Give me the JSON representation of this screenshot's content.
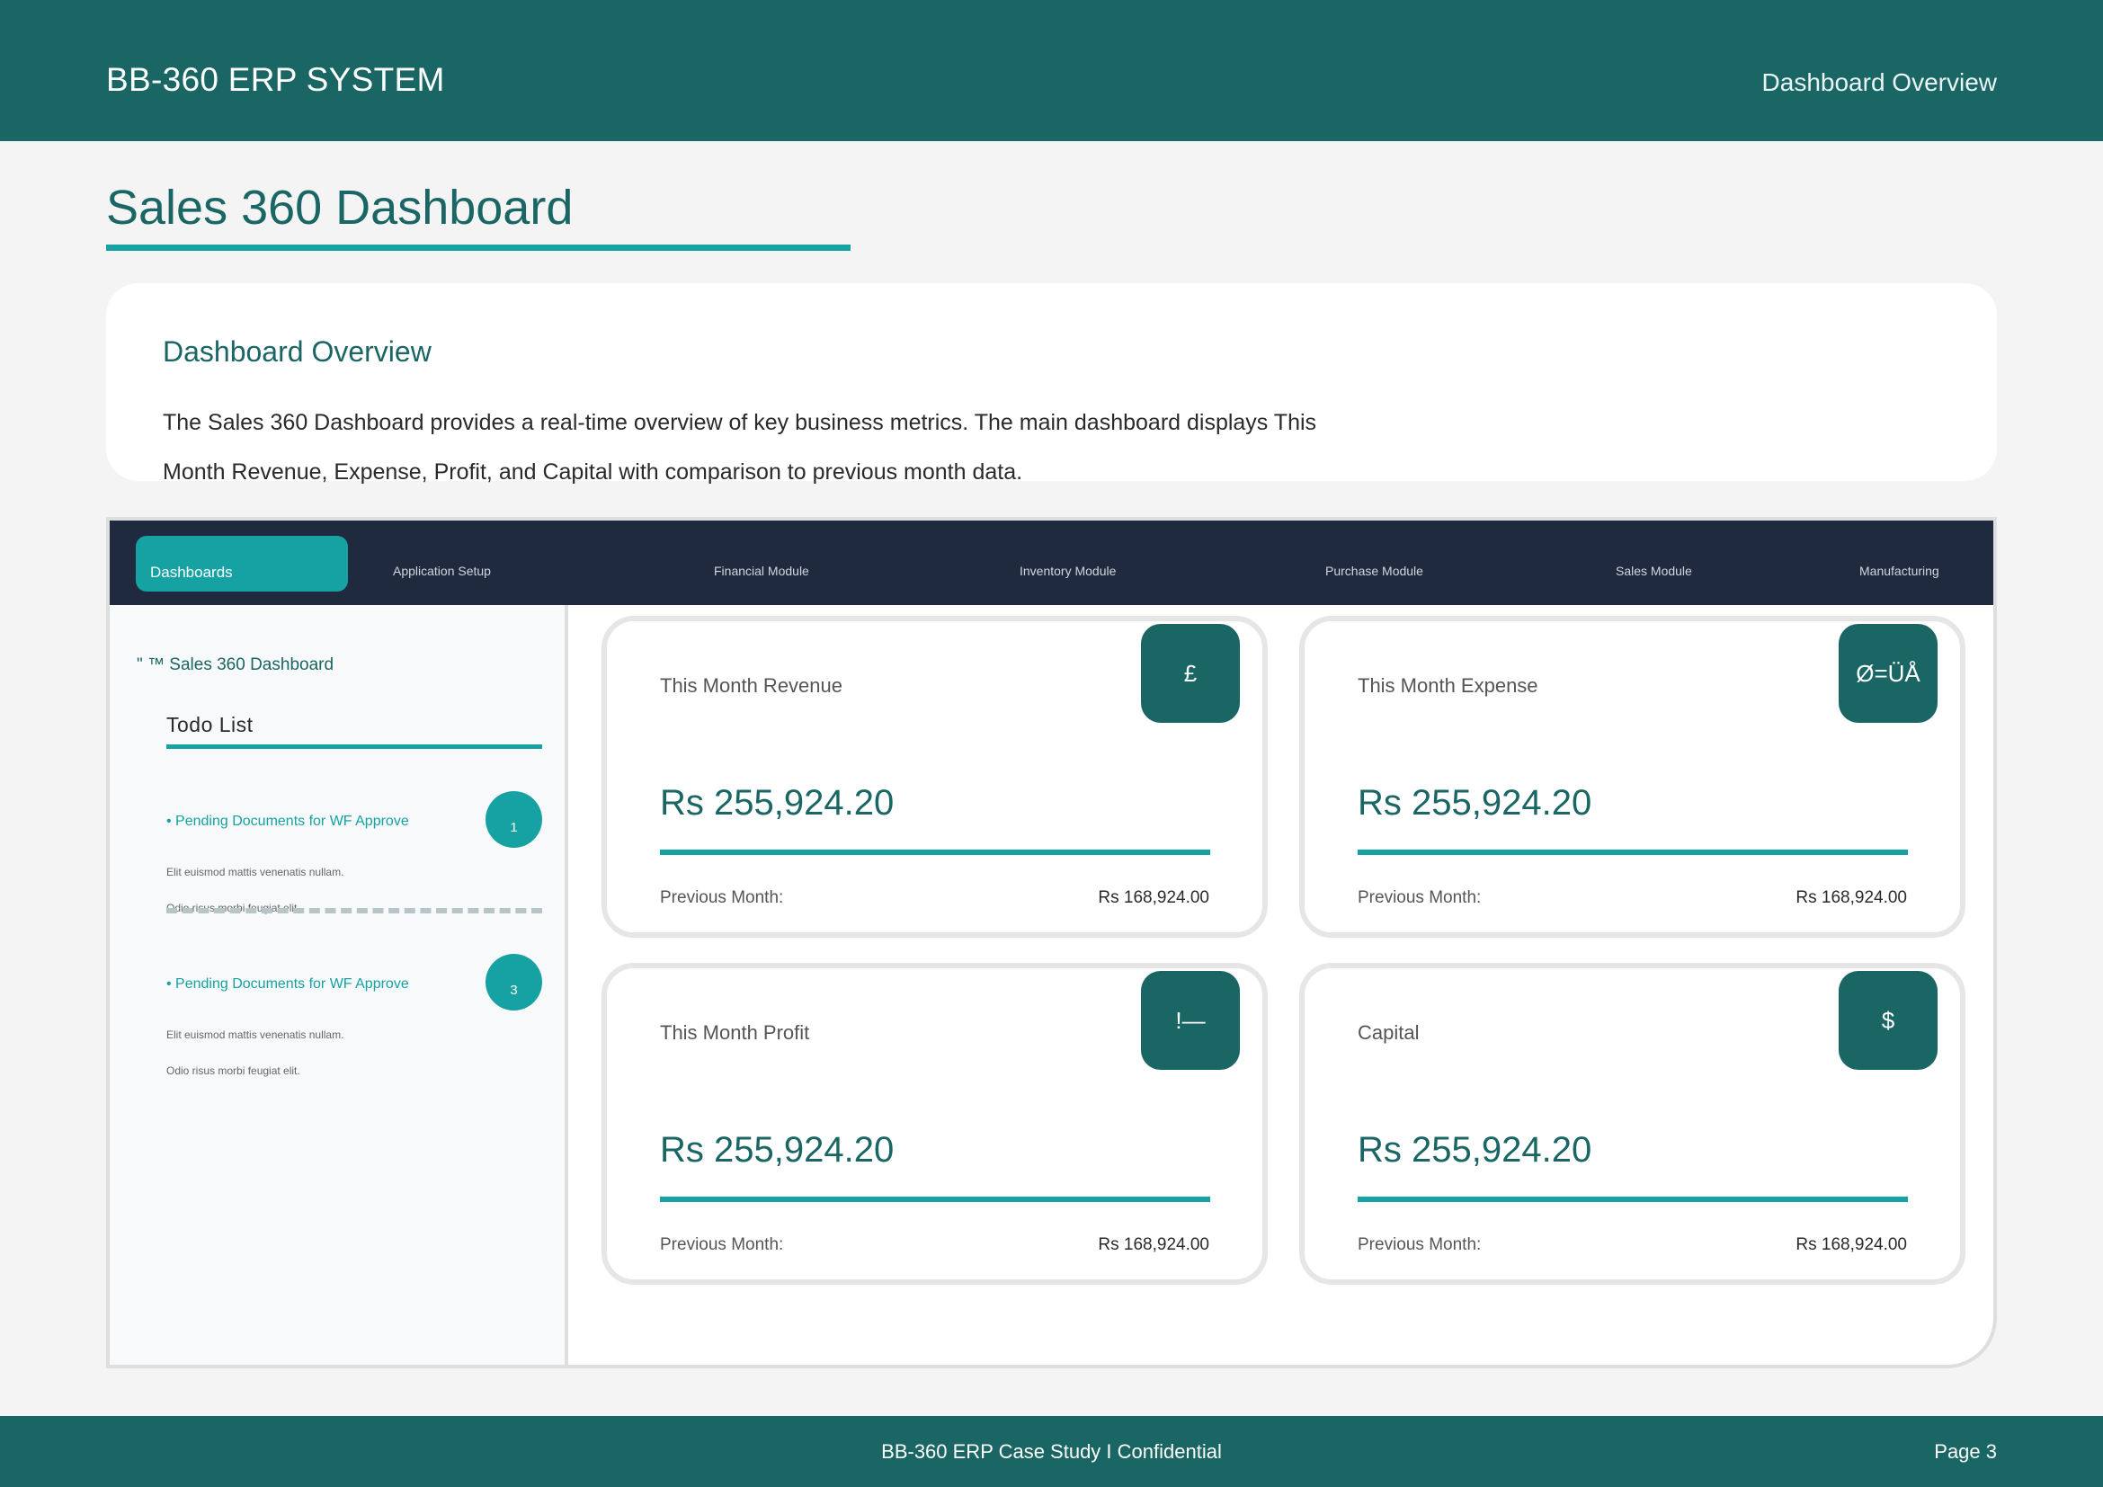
{
  "header": {
    "brand": "BB-360 ERP SYSTEM",
    "section": "Dashboard Overview"
  },
  "page_title": "Sales 360 Dashboard",
  "overview": {
    "heading": "Dashboard Overview",
    "paragraph": "The Sales 360 Dashboard provides a real-time overview of key business metrics. The main dashboard displays This Month Revenue, Expense, Profit, and Capital with comparison to previous month data."
  },
  "nav": {
    "items": [
      {
        "label": "Dashboards"
      },
      {
        "label": "Application Setup"
      },
      {
        "label": "Financial Module"
      },
      {
        "label": "Inventory Module"
      },
      {
        "label": "Purchase Module"
      },
      {
        "label": "Sales Module"
      },
      {
        "label": "Manufacturing"
      }
    ],
    "active": "Dashboards"
  },
  "sidebar": {
    "crumb": "\" ™ Sales 360 Dashboard",
    "todo_title": "Todo List",
    "todos": [
      {
        "label": "• Pending Documents for WF Approve",
        "count": "1",
        "line1": "Elit euismod mattis venenatis nullam.",
        "line2": "Odio risus morbi feugiat elit."
      },
      {
        "label": "• Pending Documents for WF Approve",
        "count": "3",
        "line1": "Elit euismod mattis venenatis nullam.",
        "line2": "Odio risus morbi feugiat elit."
      }
    ]
  },
  "metrics": [
    {
      "label": "This Month Revenue",
      "icon_glyph": "£",
      "icon": "pound-icon",
      "value": "Rs 255,924.20",
      "prev_label": "Previous Month:",
      "prev_value": "Rs 168,924.00"
    },
    {
      "label": "This Month Expense",
      "icon_glyph": "Ø=ÜÅ",
      "icon": "expense-icon",
      "value": "Rs 255,924.20",
      "prev_label": "Previous Month:",
      "prev_value": "Rs 168,924.00"
    },
    {
      "label": "This Month Profit",
      "icon_glyph": "!—",
      "icon": "profit-icon",
      "value": "Rs 255,924.20",
      "prev_label": "Previous Month:",
      "prev_value": "Rs 168,924.00"
    },
    {
      "label": "Capital",
      "icon_glyph": "$",
      "icon": "dollar-icon",
      "value": "Rs 255,924.20",
      "prev_label": "Previous Month:",
      "prev_value": "Rs 168,924.00"
    }
  ],
  "footer": {
    "center": "BB-360 ERP Case Study  I  Confidential",
    "page": "Page 3"
  },
  "colors": {
    "primary": "#1a6664",
    "accent": "#16a2a2",
    "nav_bg": "#1f2a3e",
    "page_bg": "#f4f4f4"
  }
}
